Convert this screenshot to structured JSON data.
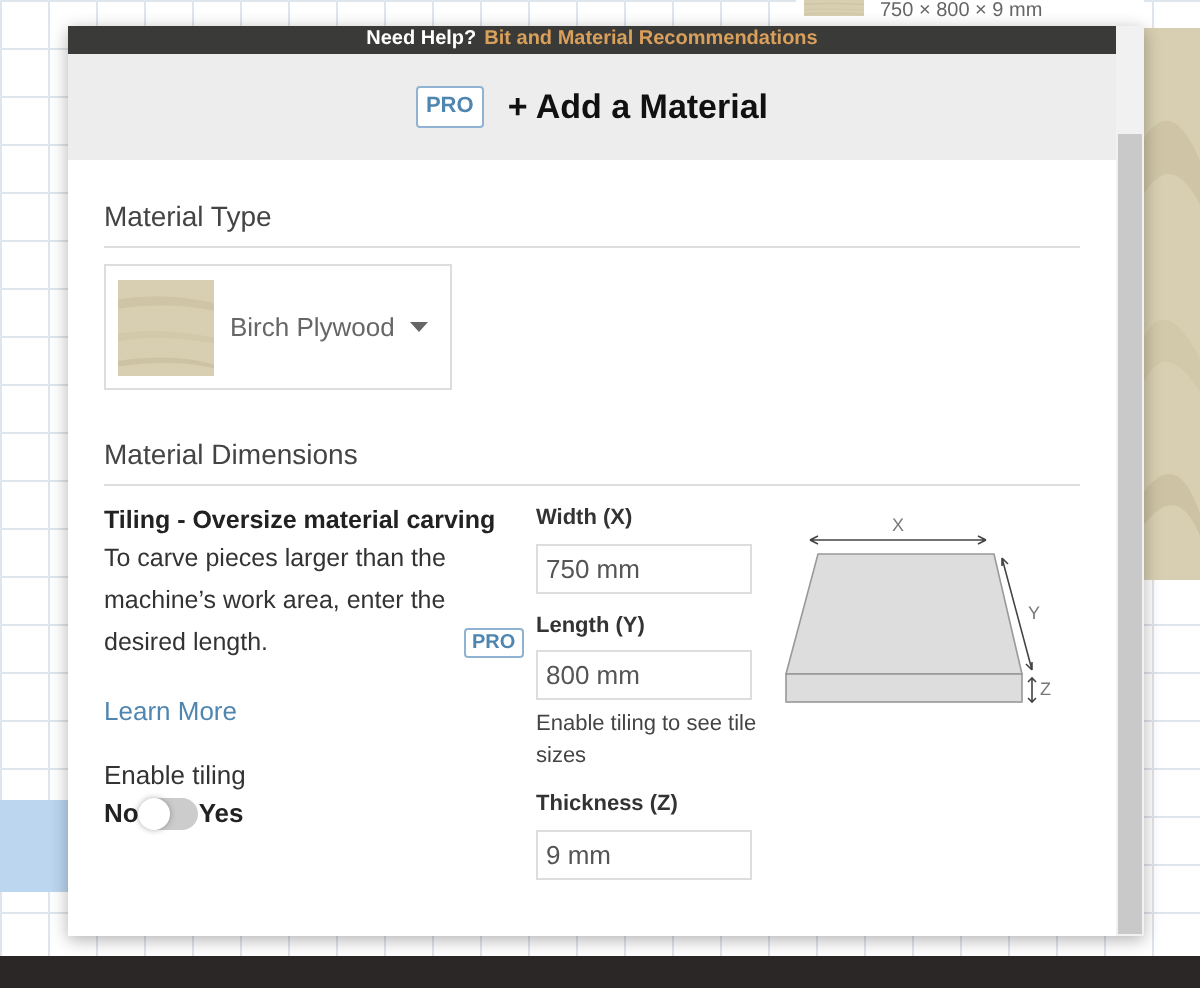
{
  "help_bar": {
    "label": "Need Help?",
    "link": "Bit and Material Recommendations"
  },
  "background": {
    "material_label": "750 × 800 × 9 mm"
  },
  "dialog": {
    "badge": "PRO",
    "title": "+ Add a Material",
    "material_type": {
      "heading": "Material Type",
      "selected": "Birch Plywood"
    },
    "dimensions": {
      "heading": "Material Dimensions",
      "tiling": {
        "title": "Tiling - Oversize material carving",
        "description": "To carve pieces larger than the machine’s work area, enter the desired length.",
        "badge": "PRO",
        "link": "Learn More",
        "toggle_label": "Enable tiling",
        "off_label": "No",
        "on_label": "Yes",
        "on": false
      },
      "fields": [
        {
          "label": "Width (X)",
          "value": "750 mm"
        },
        {
          "label": "Length (Y)",
          "value": "800 mm",
          "hint": "Enable tiling to see tile sizes"
        },
        {
          "label": "Thickness (Z)",
          "value": "9 mm"
        }
      ],
      "diagram": {
        "x": "X",
        "y": "Y",
        "z": "Z"
      }
    }
  }
}
